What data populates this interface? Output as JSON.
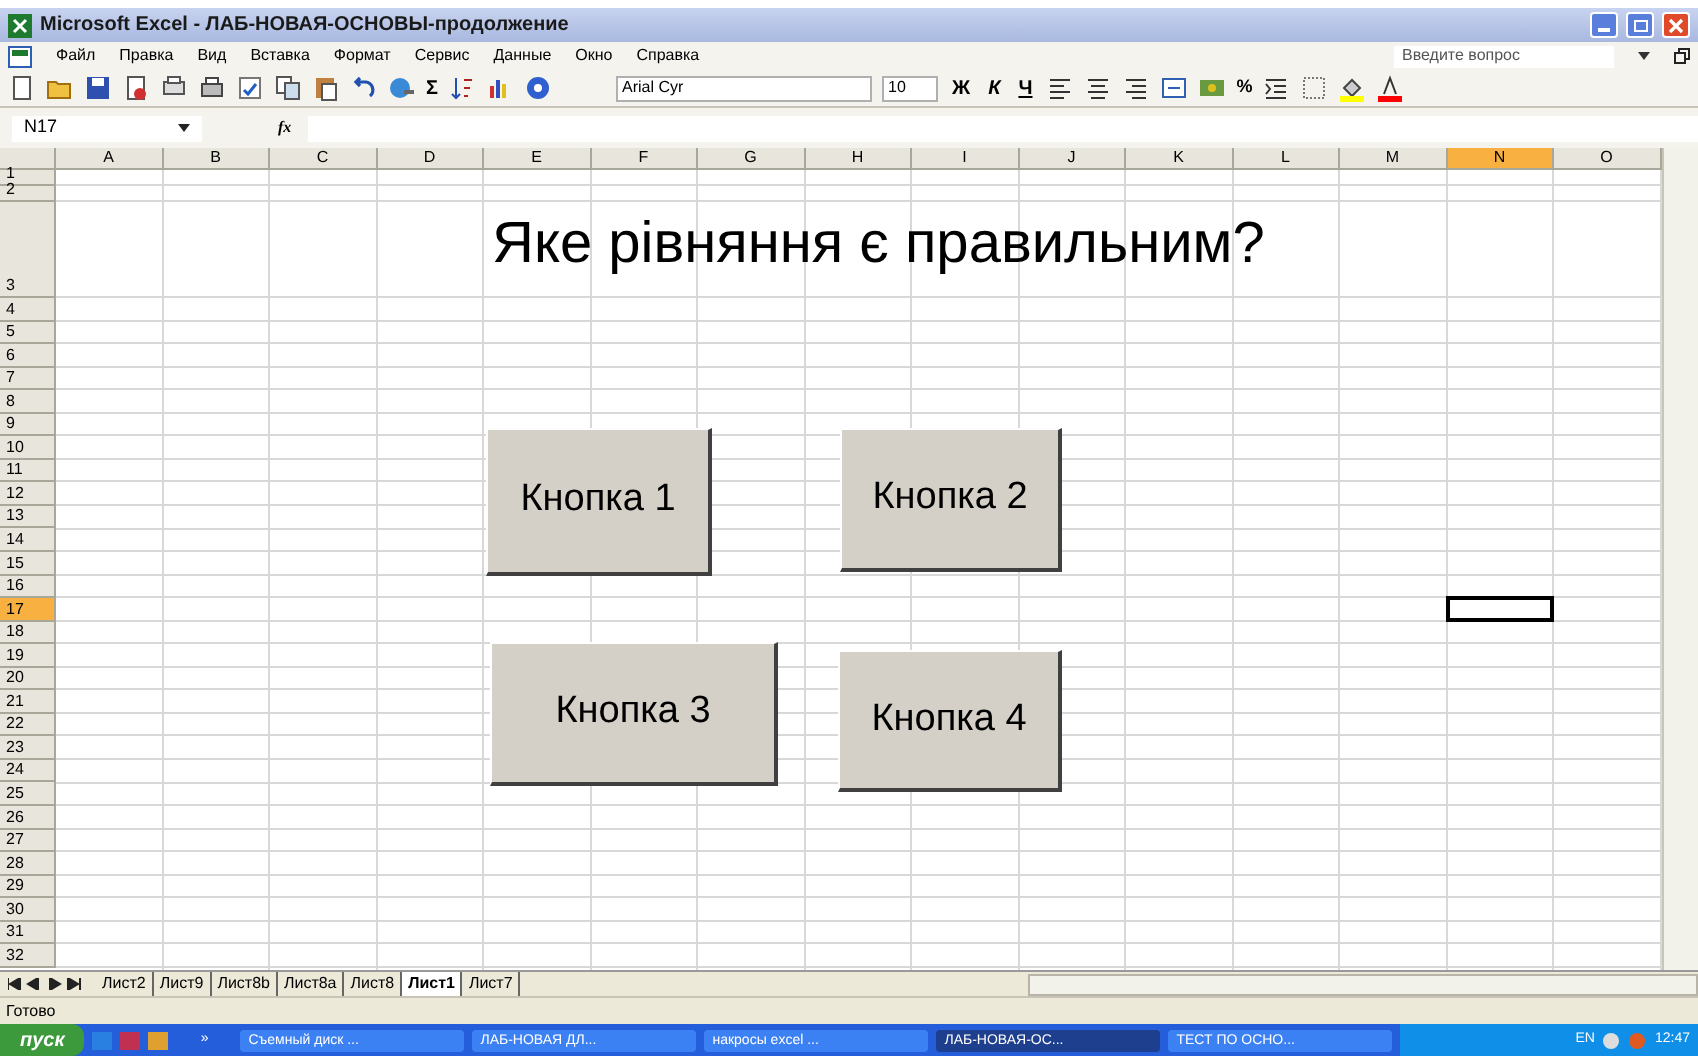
{
  "window": {
    "title": "Microsoft Excel - ЛАБ-НОВАЯ-ОСНОВЫ-продолжение"
  },
  "menu": [
    "Файл",
    "Правка",
    "Вид",
    "Вставка",
    "Формат",
    "Сервис",
    "Данные",
    "Окно",
    "Справка"
  ],
  "help_box": {
    "placeholder": "Введите вопрос"
  },
  "toolbar": {
    "font": "Arial Cyr",
    "size": "10",
    "bold": "Ж",
    "italic": "К",
    "underline": "Ч",
    "percent": "%",
    "sum": "Σ"
  },
  "formula_bar": {
    "name_box": "N17",
    "fx": "fx"
  },
  "columns": [
    {
      "label": "A",
      "selected": false
    },
    {
      "label": "B",
      "selected": false
    },
    {
      "label": "C",
      "selected": false
    },
    {
      "label": "D",
      "selected": false
    },
    {
      "label": "E",
      "selected": false
    },
    {
      "label": "F",
      "selected": false
    },
    {
      "label": "G",
      "selected": false
    },
    {
      "label": "H",
      "selected": false
    },
    {
      "label": "I",
      "selected": false
    },
    {
      "label": "J",
      "selected": false
    },
    {
      "label": "K",
      "selected": false
    },
    {
      "label": "L",
      "selected": false
    },
    {
      "label": "M",
      "selected": false
    },
    {
      "label": "N",
      "selected": true
    },
    {
      "label": "O",
      "selected": false
    }
  ],
  "rows": [
    {
      "label": "1",
      "selected": false
    },
    {
      "label": "2",
      "selected": false
    },
    {
      "label": "3",
      "selected": false
    },
    {
      "label": "4",
      "selected": false
    },
    {
      "label": "5",
      "selected": false
    },
    {
      "label": "6",
      "selected": false
    },
    {
      "label": "7",
      "selected": false
    },
    {
      "label": "8",
      "selected": false
    },
    {
      "label": "9",
      "selected": false
    },
    {
      "label": "10",
      "selected": false
    },
    {
      "label": "11",
      "selected": false
    },
    {
      "label": "12",
      "selected": false
    },
    {
      "label": "13",
      "selected": false
    },
    {
      "label": "14",
      "selected": false
    },
    {
      "label": "15",
      "selected": false
    },
    {
      "label": "16",
      "selected": false
    },
    {
      "label": "17",
      "selected": true
    },
    {
      "label": "18",
      "selected": false
    },
    {
      "label": "19",
      "selected": false
    },
    {
      "label": "20",
      "selected": false
    },
    {
      "label": "21",
      "selected": false
    },
    {
      "label": "22",
      "selected": false
    },
    {
      "label": "23",
      "selected": false
    },
    {
      "label": "24",
      "selected": false
    },
    {
      "label": "25",
      "selected": false
    },
    {
      "label": "26",
      "selected": false
    },
    {
      "label": "27",
      "selected": false
    },
    {
      "label": "28",
      "selected": false
    },
    {
      "label": "29",
      "selected": false
    },
    {
      "label": "30",
      "selected": false
    },
    {
      "label": "31",
      "selected": false
    },
    {
      "label": "32",
      "selected": false
    }
  ],
  "question": "Яке рівняння є правильним?",
  "buttons": [
    "Кнопка 1",
    "Кнопка 2",
    "Кнопка 3",
    "Кнопка 4"
  ],
  "sheet_tabs": [
    {
      "label": "Лист2",
      "selected": false
    },
    {
      "label": "Лист9",
      "selected": false
    },
    {
      "label": "Лист8b",
      "selected": false
    },
    {
      "label": "Лист8a",
      "selected": false
    },
    {
      "label": "Лист8",
      "selected": false
    },
    {
      "label": "Лист1",
      "selected": true
    },
    {
      "label": "Лист7",
      "selected": false
    }
  ],
  "status_bar": "Готово",
  "taskbar": {
    "start": "пуск",
    "more": "»",
    "tasks": [
      {
        "label": "Съемный диск ...",
        "selected": false
      },
      {
        "label": "ЛАБ-НОВАЯ ДЛ...",
        "selected": false
      },
      {
        "label": "накросы excel ...",
        "selected": false
      },
      {
        "label": "ЛАБ-НОВАЯ-ОС...",
        "selected": true
      },
      {
        "label": "ТЕСТ ПО ОСНО...",
        "selected": false
      }
    ],
    "lang": "EN",
    "time": "12:47"
  }
}
